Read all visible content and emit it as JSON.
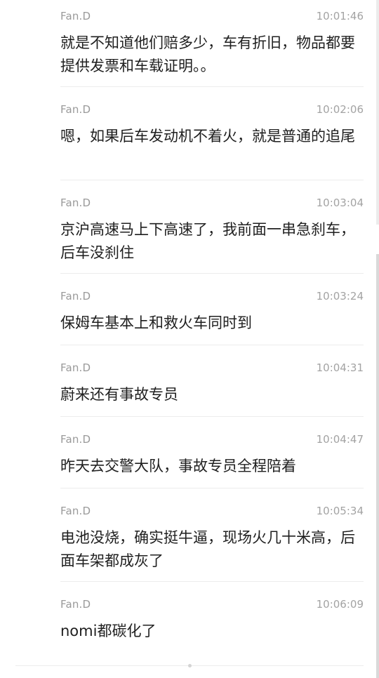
{
  "messages": [
    {
      "sender": "Fan.D",
      "time": "10:01:46",
      "text": "就是不知道他们赔多少，车有折旧，物品都要提供发票和车载证明。。"
    },
    {
      "sender": "Fan.D",
      "time": "10:02:06",
      "text": "嗯，如果后车发动机不着火，就是普通的追尾"
    },
    {
      "sender": "Fan.D",
      "time": "10:03:04",
      "text": "京沪高速马上下高速了，我前面一串急刹车，后车没刹住"
    },
    {
      "sender": "Fan.D",
      "time": "10:03:24",
      "text": "保姆车基本上和救火车同时到"
    },
    {
      "sender": "Fan.D",
      "time": "10:04:31",
      "text": "蔚来还有事故专员"
    },
    {
      "sender": "Fan.D",
      "time": "10:04:47",
      "text": "昨天去交警大队，事故专员全程陪着"
    },
    {
      "sender": "Fan.D",
      "time": "10:05:34",
      "text": "电池没烧，确实挺牛逼，现场火几十米高，后面车架都成灰了"
    },
    {
      "sender": "Fan.D",
      "time": "10:06:09",
      "text": "nomi都碳化了"
    }
  ]
}
